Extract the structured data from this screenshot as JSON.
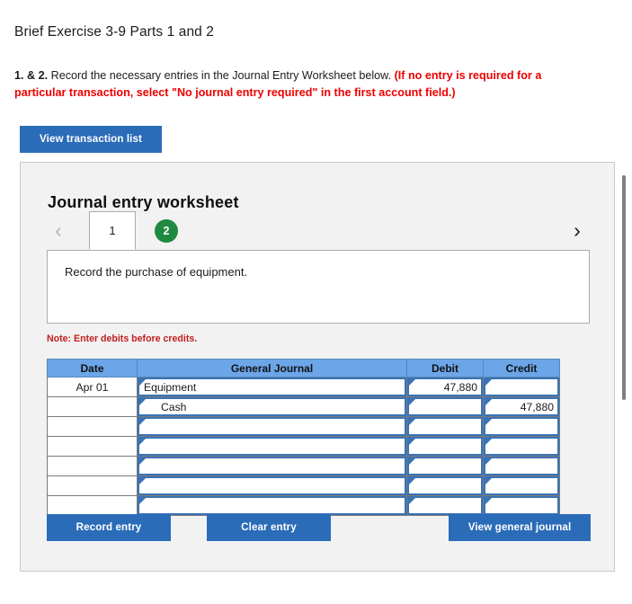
{
  "page_title": "Brief Exercise 3-9 Parts 1 and 2",
  "instructions": {
    "lead": "1. & 2.",
    "body": " Record the necessary entries in the Journal Entry Worksheet below. ",
    "warning": "(If no entry is required for a particular transaction, select \"No journal entry required\" in the first account field.)"
  },
  "toolbar": {
    "view_transaction_list_label": "View transaction list"
  },
  "worksheet": {
    "heading": "Journal entry worksheet",
    "prev_arrow": "‹",
    "next_arrow": "›",
    "tabs": [
      {
        "label": "1",
        "state": "active"
      },
      {
        "label": "2",
        "state": "complete"
      }
    ],
    "prompt": "Record the purchase of equipment.",
    "note": "Note: Enter debits before credits."
  },
  "table": {
    "headers": [
      "Date",
      "General Journal",
      "Debit",
      "Credit"
    ],
    "rows": [
      {
        "date": "Apr 01",
        "account": "Equipment",
        "indent": false,
        "debit": "47,880",
        "credit": ""
      },
      {
        "date": "",
        "account": "Cash",
        "indent": true,
        "debit": "",
        "credit": "47,880"
      },
      {
        "date": "",
        "account": "",
        "indent": false,
        "debit": "",
        "credit": ""
      },
      {
        "date": "",
        "account": "",
        "indent": false,
        "debit": "",
        "credit": ""
      },
      {
        "date": "",
        "account": "",
        "indent": false,
        "debit": "",
        "credit": ""
      },
      {
        "date": "",
        "account": "",
        "indent": false,
        "debit": "",
        "credit": ""
      },
      {
        "date": "",
        "account": "",
        "indent": false,
        "debit": "",
        "credit": ""
      }
    ]
  },
  "actions": {
    "record_entry_label": "Record entry",
    "clear_entry_label": "Clear entry",
    "view_general_journal_label": "View general journal"
  },
  "colors": {
    "button_blue": "#2b6cb8",
    "table_header_blue": "#6ca6e8",
    "input_border_blue": "#3a73b5",
    "badge_green": "#1f8a3f",
    "warning_red": "#ee0000",
    "note_red": "#c21f1f",
    "panel_bg": "#f2f2f2"
  }
}
